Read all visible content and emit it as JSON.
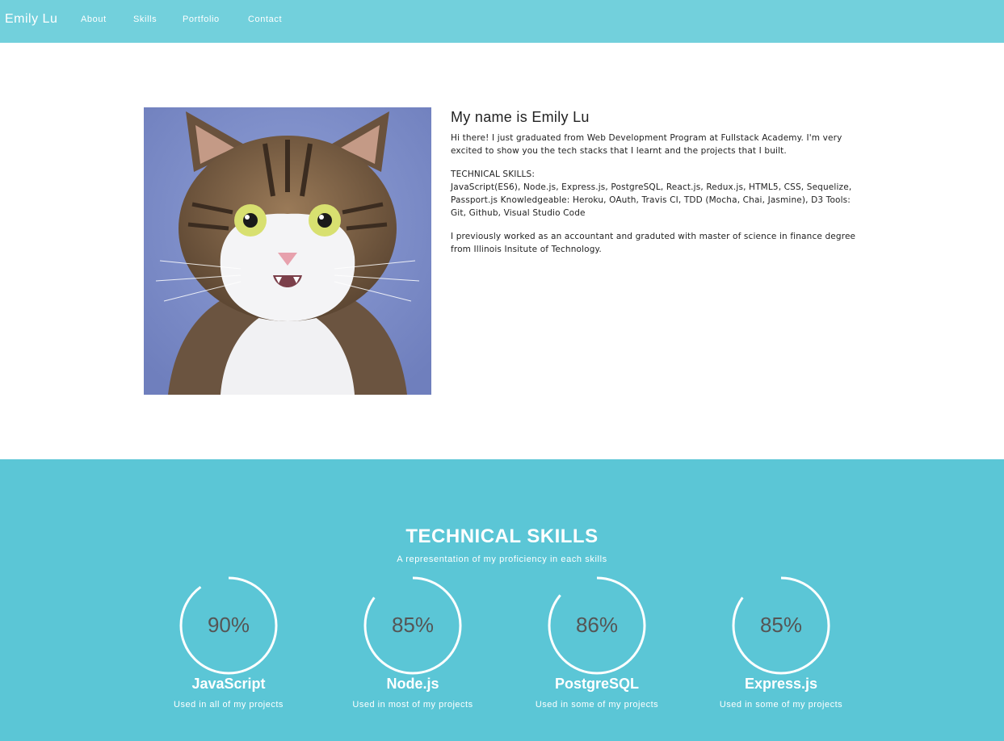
{
  "nav": {
    "brand": "Emily Lu",
    "links": [
      "About",
      "Skills",
      "Portfolio",
      "Contact"
    ],
    "background": "#72d0dc"
  },
  "about": {
    "photo": "cat-photo",
    "title": "My name is Emily Lu",
    "paragraphs": [
      "Hi there! I just graduated from Web Development Program at Fullstack Academy. I'm very excited to show you the tech stacks that I learnt and the projects that I built.",
      "TECHNICAL SKILLS:",
      "JavaScript(ES6), Node.js, Express.js, PostgreSQL, React.js, Redux.js, HTML5, CSS, Sequelize, Passport.js Knowledgeable: Heroku, OAuth, Travis CI, TDD (Mocha, Chai, Jasmine), D3 Tools: Git, Github, Visual Studio Code",
      "I previously worked as an accountant and graduted with master of science in finance degree from Illinois Insitute of Technology."
    ]
  },
  "skills": {
    "title": "TECHNICAL SKILLS",
    "subtitle": "A representation of my proficiency in each skills",
    "background": "#5bc6d6",
    "items": [
      {
        "percent": "90%",
        "value": 90,
        "name": "JavaScript",
        "desc": "Used in all of my projects"
      },
      {
        "percent": "85%",
        "value": 85,
        "name": "Node.js",
        "desc": "Used in most of my projects"
      },
      {
        "percent": "86%",
        "value": 86,
        "name": "PostgreSQL",
        "desc": "Used in some of my projects"
      },
      {
        "percent": "85%",
        "value": 85,
        "name": "Express.js",
        "desc": "Used in some of my projects"
      }
    ]
  }
}
